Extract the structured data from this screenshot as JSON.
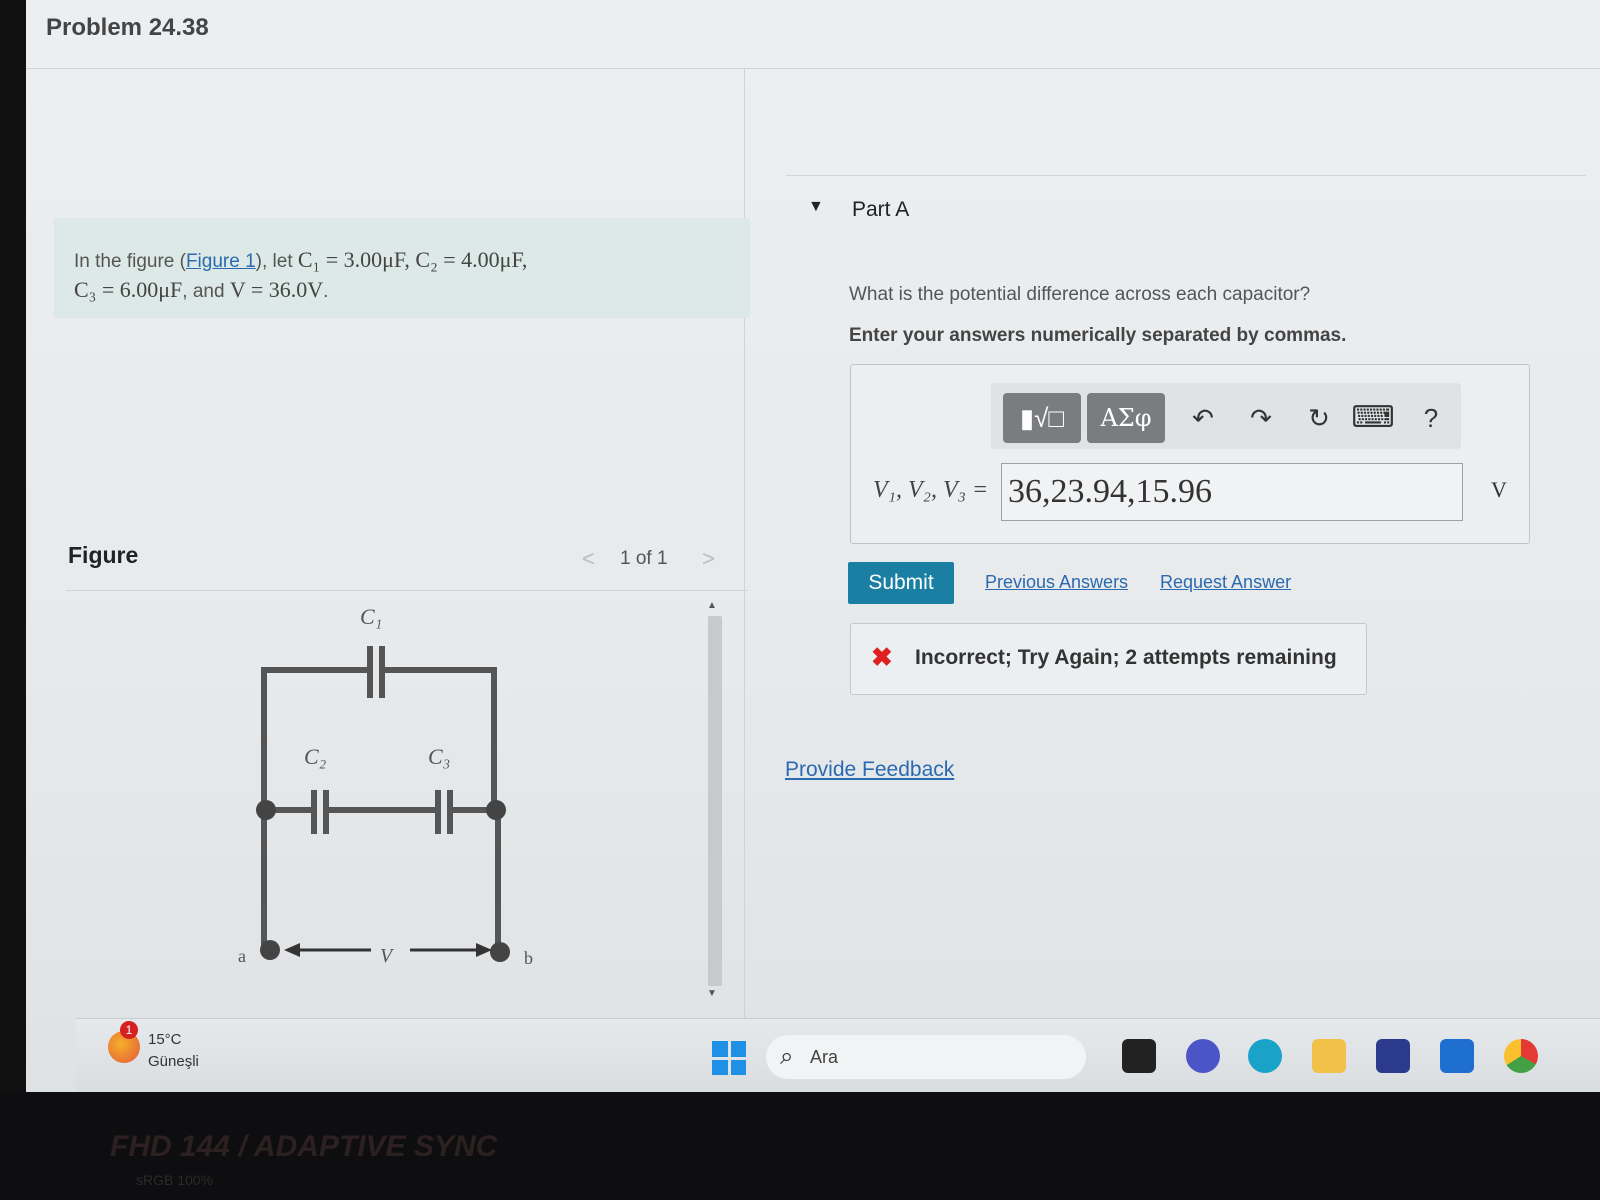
{
  "problem": {
    "title": "Problem 24.38",
    "statement_prefix": "In the figure (",
    "figure_link": "Figure 1",
    "statement_mid": "), let ",
    "math1": "C₁ = 3.00μF, C₂ = 4.00μF,",
    "math2": "C₃ = 6.00μF",
    "statement_and": ", and ",
    "math3": "V = 36.0V",
    "statement_end": "."
  },
  "figure": {
    "label": "Figure",
    "pager_prev": "<",
    "pager": "1 of 1",
    "pager_next": ">",
    "c1": "C₁",
    "c2": "C₂",
    "c3": "C₃",
    "node_a": "a",
    "node_b": "b",
    "v_label": "V"
  },
  "part_a": {
    "title": "Part A",
    "question": "What is the potential difference across each capacitor?",
    "instruction": "Enter your answers numerically separated by commas.",
    "toolbar": {
      "templates": "▮√□",
      "symbols": "ΑΣφ",
      "undo": "↶",
      "redo": "↷",
      "reset": "↻",
      "keyboard": "⌨",
      "help": "?"
    },
    "answer_label": "V₁, V₂, V₃ =",
    "answer_value": "36,23.94,15.96",
    "answer_unit": "V",
    "submit": "Submit",
    "previous_answers": "Previous Answers",
    "request_answer": "Request Answer",
    "feedback_icon": "✖",
    "feedback": "Incorrect; Try Again; 2 attempts remaining",
    "provide_feedback": "Provide Feedback"
  },
  "taskbar": {
    "weather_badge": "1",
    "weather_temp": "15°C",
    "weather_location": "Güneşli",
    "search_icon": "search-icon",
    "search_placeholder": "Ara",
    "app_icons": [
      "file-explorer-icon",
      "chat-icon",
      "edge-icon",
      "folder-icon",
      "store-icon",
      "mail-icon",
      "chrome-icon"
    ]
  },
  "bezel": {
    "brand": "FHD 144 / ADAPTIVE SYNC",
    "sub": "sRGB 100%"
  },
  "colors": {
    "accent": "#1b7fa3",
    "link": "#2a6ab0",
    "error": "#e02020",
    "statement_bg": "#dce9e6"
  }
}
